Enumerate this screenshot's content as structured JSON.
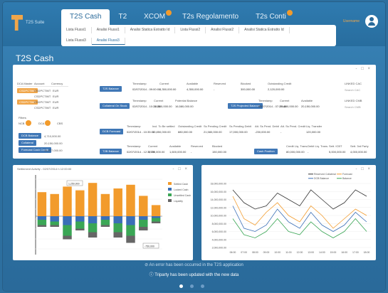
{
  "app": {
    "logo_text": "T2S Suite",
    "username": "Username"
  },
  "tabs": [
    {
      "label": "T2S Cash",
      "active": true,
      "badge": false
    },
    {
      "label": "T2",
      "active": false,
      "badge": false
    },
    {
      "label": "XCOM",
      "active": false,
      "badge": true
    },
    {
      "label": "T2s Regolamento",
      "active": false,
      "badge": false
    },
    {
      "label": "T2s Conti",
      "active": false,
      "badge": true
    }
  ],
  "subtabs_row1": [
    "Lista Flussi1",
    "Analisi Flussi1",
    "Analisi Statica Estratto Id",
    "Lista Flussi2",
    "Analisi Flussi2",
    "Analisi Statica Estratto Id"
  ],
  "subtabs_row2": [
    "Lista Flussi3",
    "Analisi Flussi3"
  ],
  "page_title": "T2S Cash",
  "top_panel": {
    "win_ctrls": "- □ ×",
    "left_list": {
      "headers": [
        "DCA Master",
        "Account",
        "Currency"
      ],
      "rows": [
        {
          "a": "CSDPCTIMT",
          "b": "CSDPCTIMT",
          "c": "EUR",
          "orange": true
        },
        {
          "a": "",
          "b": "CSDPCTIMT",
          "c": "EUR",
          "orange": false
        },
        {
          "a": "CSDPCTIMT",
          "b": "CSDPCTIMT",
          "c": "EUR",
          "orange": true
        },
        {
          "a": "",
          "b": "CSDPCTIMT",
          "c": "EUR",
          "orange": false
        }
      ],
      "filter_label": "Filters",
      "filter_a": "NCB",
      "filter_b": "DCA",
      "filter_c": "CBS"
    },
    "summary": [
      {
        "label": "DCB Balance",
        "value": "4,710,000.00"
      },
      {
        "label": "Collateral",
        "value": "20,150,000.00"
      },
      {
        "label": "Forecast Cash Credit",
        "value": "14,877,000.00"
      }
    ],
    "t2s_balance": {
      "button": "T2S Balance",
      "headers": [
        "Timestamp",
        "Current",
        "Available",
        "Reserved",
        "Blocked",
        "Outstanding Credit"
      ],
      "values": [
        "02/07/2014 - 09:00:00",
        "4,350,000.00",
        "4,350,000.00",
        "-",
        "300,000.00",
        "2,120,000.00"
      ]
    },
    "linked_cac": {
      "label": "LINKED CAC",
      "value": "Search CAC"
    },
    "collateral": {
      "button": "Collateral On Stock",
      "headers": [
        "Timestamp",
        "Current",
        "Potential Balance"
      ],
      "values": [
        "02/07/2014 - 10:21:35",
        "16,580,000.00",
        "16,580,000.00"
      ]
    },
    "projected": {
      "button": "T2S Projected Balance",
      "headers": [
        "Timestamp",
        "Current",
        "Available"
      ],
      "values": [
        "02/07/2014 - 07:29:48",
        "20,150,000.00",
        "20,150,000.00"
      ]
    },
    "linked_cmb": {
      "label": "LINKED CMB",
      "value": "Search CMB"
    },
    "forecast": {
      "button": "DCB Forecast",
      "headers": [
        "Timestamp",
        "Incl. To Be settled",
        "Outstanding Credit",
        "Ss Pending Credit",
        "Ss Pending Debit",
        "Att. Ss Pend. Debit",
        "Att. Ss Pend. Credit",
        "Liq. Transfer"
      ],
      "values": [
        "02/07/2014 - 10:35:00",
        "10,850,000.00",
        "880,000.00",
        "21,580,000.00",
        "17,000,000.00",
        "-230,000.00",
        "-",
        "120,000.00"
      ]
    },
    "t2b": {
      "button": "T2B Balance",
      "headers": [
        "Timestamp",
        "Current",
        "Available",
        "Reserved",
        "Blocked"
      ],
      "values": [
        "02/07/2014 - 12:35:29",
        "1,750,000.00",
        "1,600,000.00",
        "-",
        "150,000.00"
      ]
    },
    "cash_position": {
      "button": "Cash Position",
      "headers": [
        "Credit Liq. Trans.",
        "Debit Liq. Trans.",
        "Sett. ICBT",
        "Sett. 3rd Party"
      ],
      "values": [
        "80,000,000.00",
        "-",
        "5,000,000.00",
        "4,000,000.00"
      ]
    }
  },
  "bar_panel": {
    "title": "Settlement Activity - 02/07/2014 h 12:00:00",
    "win_ctrls": "- □ ×"
  },
  "line_panel": {
    "win_ctrls": "- □ ×"
  },
  "chart_data": [
    {
      "type": "bar",
      "title": "Settlement Activity",
      "categories": [
        "1",
        "2",
        "3",
        "4",
        "5",
        "6",
        "7",
        "8",
        "9",
        "10"
      ],
      "series": [
        {
          "name": "Settled Cash",
          "values": [
            130,
            120,
            160,
            140,
            180,
            120,
            150,
            170,
            110,
            60
          ]
        },
        {
          "name": "Locked Cash",
          "values": [
            -20,
            -30,
            -50,
            -30,
            -40,
            -20,
            -40,
            -50,
            -20,
            -10
          ]
        },
        {
          "name": "Unsettled Cash",
          "values": [
            -30,
            -20,
            -60,
            -40,
            -50,
            -30,
            -50,
            -60,
            -40,
            -20
          ]
        },
        {
          "name": "Liquidity",
          "values": [
            -10,
            -10,
            -20,
            -10,
            -30,
            -10,
            -30,
            -40,
            -20,
            -10
          ]
        }
      ],
      "colors": [
        "#f29b2c",
        "#3a6fb7",
        "#3aa655",
        "#666666"
      ],
      "legend_position": "right",
      "annotations": [
        "1,250,000",
        "-750,000"
      ]
    },
    {
      "type": "line",
      "x": [
        "06:00",
        "07:00",
        "08:00",
        "09:00",
        "10:00",
        "11:00",
        "12:00",
        "13:00",
        "14:00",
        "15:00",
        "16:00",
        "17:00",
        "18:00"
      ],
      "series": [
        {
          "name": "Reserved Collateral",
          "values": [
            1800,
            1400,
            1200,
            1300,
            1700,
            1500,
            1300,
            1800,
            1500,
            1200,
            1400,
            1800,
            1600
          ]
        },
        {
          "name": "Forecast",
          "values": [
            1600,
            900,
            700,
            1100,
            1400,
            1000,
            800,
            1300,
            1000,
            600,
            900,
            1200,
            1000
          ]
        },
        {
          "name": "DCB Balance",
          "values": [
            1300,
            600,
            500,
            700,
            1200,
            800,
            600,
            1100,
            700,
            500,
            700,
            1100,
            800
          ]
        },
        {
          "name": "Balance",
          "values": [
            900,
            400,
            300,
            500,
            900,
            500,
            400,
            800,
            500,
            300,
            500,
            900,
            500
          ]
        }
      ],
      "colors": [
        "#333333",
        "#f29b2c",
        "#3a6fb7",
        "#3aa655"
      ],
      "y_labels": [
        "18,000,000.00",
        "16,000,000.00",
        "14,000,000.00",
        "12,000,000.00",
        "10,000,000.00",
        "8,000,000.00",
        "6,000,000.00",
        "4,000,000.00",
        "2,000,000.00"
      ],
      "legend_position": "top"
    }
  ],
  "notifications": [
    "An error has been occurred in the T2S application",
    "Triparty has been updated with the new data"
  ]
}
